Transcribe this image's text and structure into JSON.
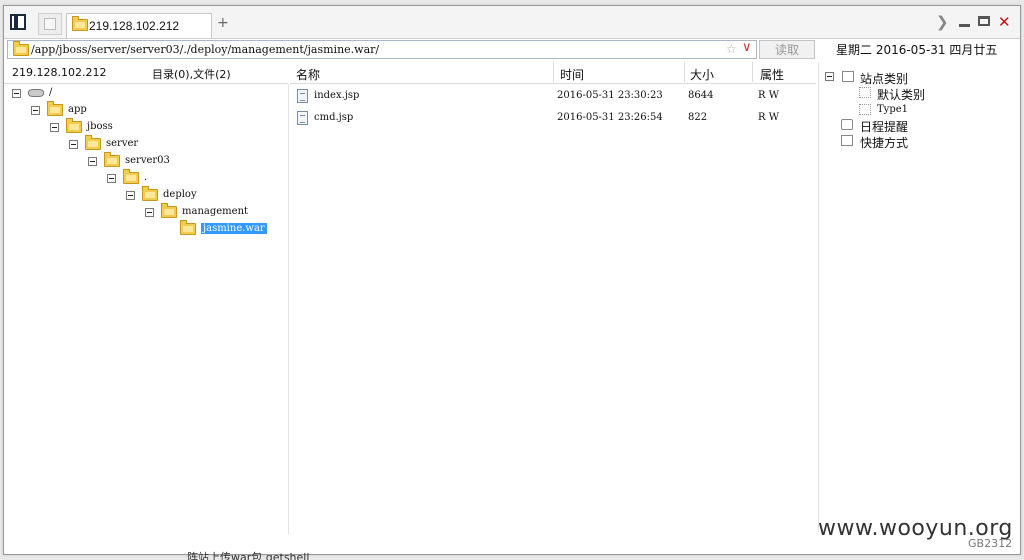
{
  "tab": {
    "title": "219.128.102.212",
    "add_label": "+"
  },
  "address": {
    "path": "/app/jboss/server/server03/./deploy/management/jasmine.war/",
    "read_button": "读取"
  },
  "datebar": "星期二 2016-05-31 四月廿五",
  "left_panel": {
    "ip": "219.128.102.212",
    "summary": "目录(0),文件(2)"
  },
  "tree": [
    {
      "label": "/",
      "icon": "drive-icon"
    },
    {
      "label": "app",
      "icon": "folder-icon"
    },
    {
      "label": "jboss",
      "icon": "folder-icon"
    },
    {
      "label": "server",
      "icon": "folder-icon"
    },
    {
      "label": "server03",
      "icon": "folder-icon"
    },
    {
      "label": ".",
      "icon": "folder-icon"
    },
    {
      "label": "deploy",
      "icon": "folder-icon"
    },
    {
      "label": "management",
      "icon": "folder-icon"
    },
    {
      "label": "jasmine.war",
      "icon": "folder-open-icon",
      "selected": true
    }
  ],
  "file_list": {
    "columns": [
      "名称",
      "时间",
      "大小",
      "属性"
    ],
    "rows": [
      {
        "name": "index.jsp",
        "time": "2016-05-31 23:30:23",
        "size": "8644",
        "attr": "R W"
      },
      {
        "name": "cmd.jsp",
        "time": "2016-05-31 23:26:54",
        "size": "822",
        "attr": "R W"
      }
    ]
  },
  "right_panel": {
    "site_category": "站点类别",
    "default_category": "默认类别",
    "type1": "Type1",
    "schedule": "日程提醒",
    "shortcut": "快捷方式"
  },
  "watermark": "www.wooyun.org",
  "encoding": "GB2312",
  "bottom_text": "阵站上传war包 getshell",
  "colors": {
    "selection": "#3399ff",
    "close": "#cc1111",
    "folder": "#f3cc4e"
  }
}
